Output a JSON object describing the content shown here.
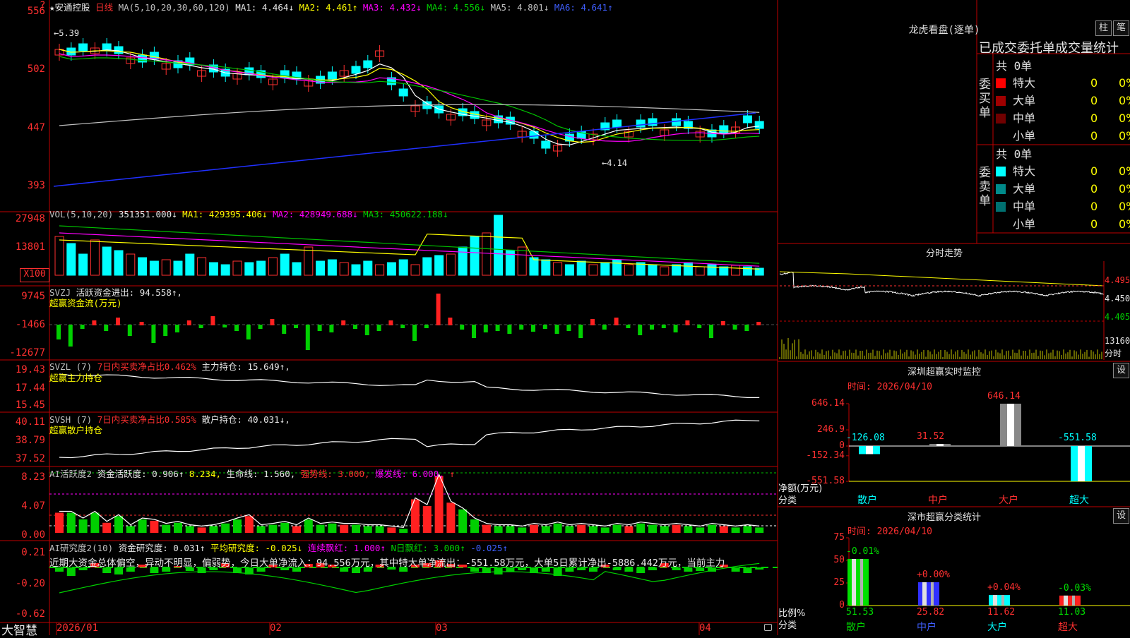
{
  "app": {
    "name": "大智慧"
  },
  "stock": {
    "name": "★安通控股",
    "period": "日线",
    "ma_header": "MA(5,10,20,30,60,120)",
    "ma1": "MA1: 4.464↓",
    "ma2": "MA2: 4.461↑",
    "ma3": "MA3: 4.432↓",
    "ma4": "MA4: 4.556↓",
    "ma5": "MA5: 4.801↓",
    "ma6": "MA6: 4.641↑",
    "max_label": "←5.39",
    "min_label": "←4.14",
    "ticks": [
      "556",
      "502",
      "447",
      "393"
    ],
    "top_marker": "?"
  },
  "vol": {
    "header": "VOL(5,10,20)",
    "value": "351351.000↓",
    "ma1": "MA1: 429395.406↓",
    "ma2": "MA2: 428949.688↓",
    "ma3": "MA3: 450622.188↓",
    "ticks": [
      "27948",
      "13801",
      "X100"
    ]
  },
  "svzj": {
    "header": "SVZJ",
    "label": "活跃资金进出: 94.558↑,",
    "sub": "超赢资金流(万元)",
    "ticks": [
      "9745",
      "-1466",
      "-12677"
    ]
  },
  "svzl": {
    "header": "SVZL (7)",
    "label1": "7日内买卖净占比0.462%",
    "label2": "主力持仓: 15.649↑,",
    "sub": "超赢主力持仓",
    "ticks": [
      "19.43",
      "17.44",
      "15.45"
    ]
  },
  "svsh": {
    "header": "SVSH (7)",
    "label1": "7日内买卖净占比0.585%",
    "label2": "散户持仓: 40.031↓,",
    "sub": "超赢散户持仓",
    "ticks": [
      "40.11",
      "38.79",
      "37.52"
    ]
  },
  "ai1": {
    "header": "AI活跃度2",
    "l1": "资金活跃度: 0.906↑",
    "l2": "8.234,",
    "l3": "生命线: 1.560,",
    "l4": "强势线: 3.000,",
    "l5": "爆发线: 6.000,",
    "l6": "↑",
    "ticks": [
      "8.23",
      "4.07",
      "0.00"
    ]
  },
  "ai2": {
    "header": "AI研究度2(10)",
    "l1": "资金研究度: 0.031↑",
    "l2": "平均研究度: -0.025↓",
    "l3": "连续飘红: 1.000↑",
    "l4": "N日飘红: 3.000↑",
    "l5": "-0.025↑",
    "note": "近期大资金总体偏空，异动不明显，偏弱势，今日大单净流入：94.556万元，其中特大单净流出：-551.58万元，大单5日累计净出-5886.442万元，当前主力",
    "ticks": [
      "0.21",
      "-0.20",
      "-0.62"
    ]
  },
  "dates": [
    "2026/01",
    "02",
    "03",
    "04"
  ],
  "lhb": {
    "title": "龙虎看盘(逐单)",
    "btn1": "柱",
    "btn2": "笔",
    "tabs": "已成交委托单成交量统计",
    "buy_side": "委买单",
    "sell_side": "委卖单",
    "buy_total": "共 0单",
    "sell_total": "共 0单",
    "buy_rows": [
      {
        "name": "特大",
        "count": "0",
        "pct": "0%",
        "color": "#ff0000"
      },
      {
        "name": "大单",
        "count": "0",
        "pct": "0%",
        "color": "#a00000"
      },
      {
        "name": "中单",
        "count": "0",
        "pct": "0%",
        "color": "#700000"
      },
      {
        "name": "小单",
        "count": "0",
        "pct": "0%",
        "color": ""
      }
    ],
    "sell_rows": [
      {
        "name": "特大",
        "count": "0",
        "pct": "0%",
        "color": "#00ffff"
      },
      {
        "name": "大单",
        "count": "0",
        "pct": "0%",
        "color": "#008a8a"
      },
      {
        "name": "中单",
        "count": "0",
        "pct": "0%",
        "color": "#007070"
      },
      {
        "name": "小单",
        "count": "0",
        "pct": "0%",
        "color": ""
      }
    ]
  },
  "intraday": {
    "title": "分时走势",
    "p1": "4.495",
    "p2": "4.450",
    "p3": "4.405",
    "vol": "13160",
    "label": "分时"
  },
  "monitor": {
    "title": "深圳超赢实时监控",
    "btn": "设",
    "time": "时间: 2026/04/10",
    "ticks": [
      "646.14",
      "246.9",
      "0",
      "-152.34",
      "-551.58"
    ],
    "ylabel": "净额(万元)",
    "xlabel": "分类",
    "bars": [
      {
        "name": "散户",
        "value": -126.08,
        "label": "-126.08",
        "cls": "cyan"
      },
      {
        "name": "中户",
        "value": 31.52,
        "label": "31.52",
        "cls": "red"
      },
      {
        "name": "大户",
        "value": 646.14,
        "label": "646.14",
        "cls": "red"
      },
      {
        "name": "超大",
        "value": -551.58,
        "label": "-551.58",
        "cls": "cyan"
      }
    ]
  },
  "stats": {
    "title": "深市超赢分类统计",
    "btn": "设",
    "time": "时间: 2026/04/10",
    "ticks": [
      "75",
      "50",
      "25",
      "0"
    ],
    "ylabel": "比例%",
    "xlabel": "分类",
    "bars": [
      {
        "name": "散户",
        "value": 51.53,
        "chg": "-0.01%",
        "color": "#00e000",
        "lblcolor": "#00e000"
      },
      {
        "name": "中户",
        "value": 25.82,
        "chg": "+0.00%",
        "color": "#3030ff",
        "lblcolor": "#ff3030"
      },
      {
        "name": "大户",
        "value": 11.62,
        "chg": "+0.04%",
        "color": "#00ffff",
        "lblcolor": "#ff3030"
      },
      {
        "name": "超大",
        "value": 11.03,
        "chg": "-0.03%",
        "color": "#ff2020",
        "lblcolor": "#00e000"
      }
    ]
  },
  "colors": {
    "up": "#ff3030",
    "down": "#00ffff",
    "grid": "#c00000"
  }
}
